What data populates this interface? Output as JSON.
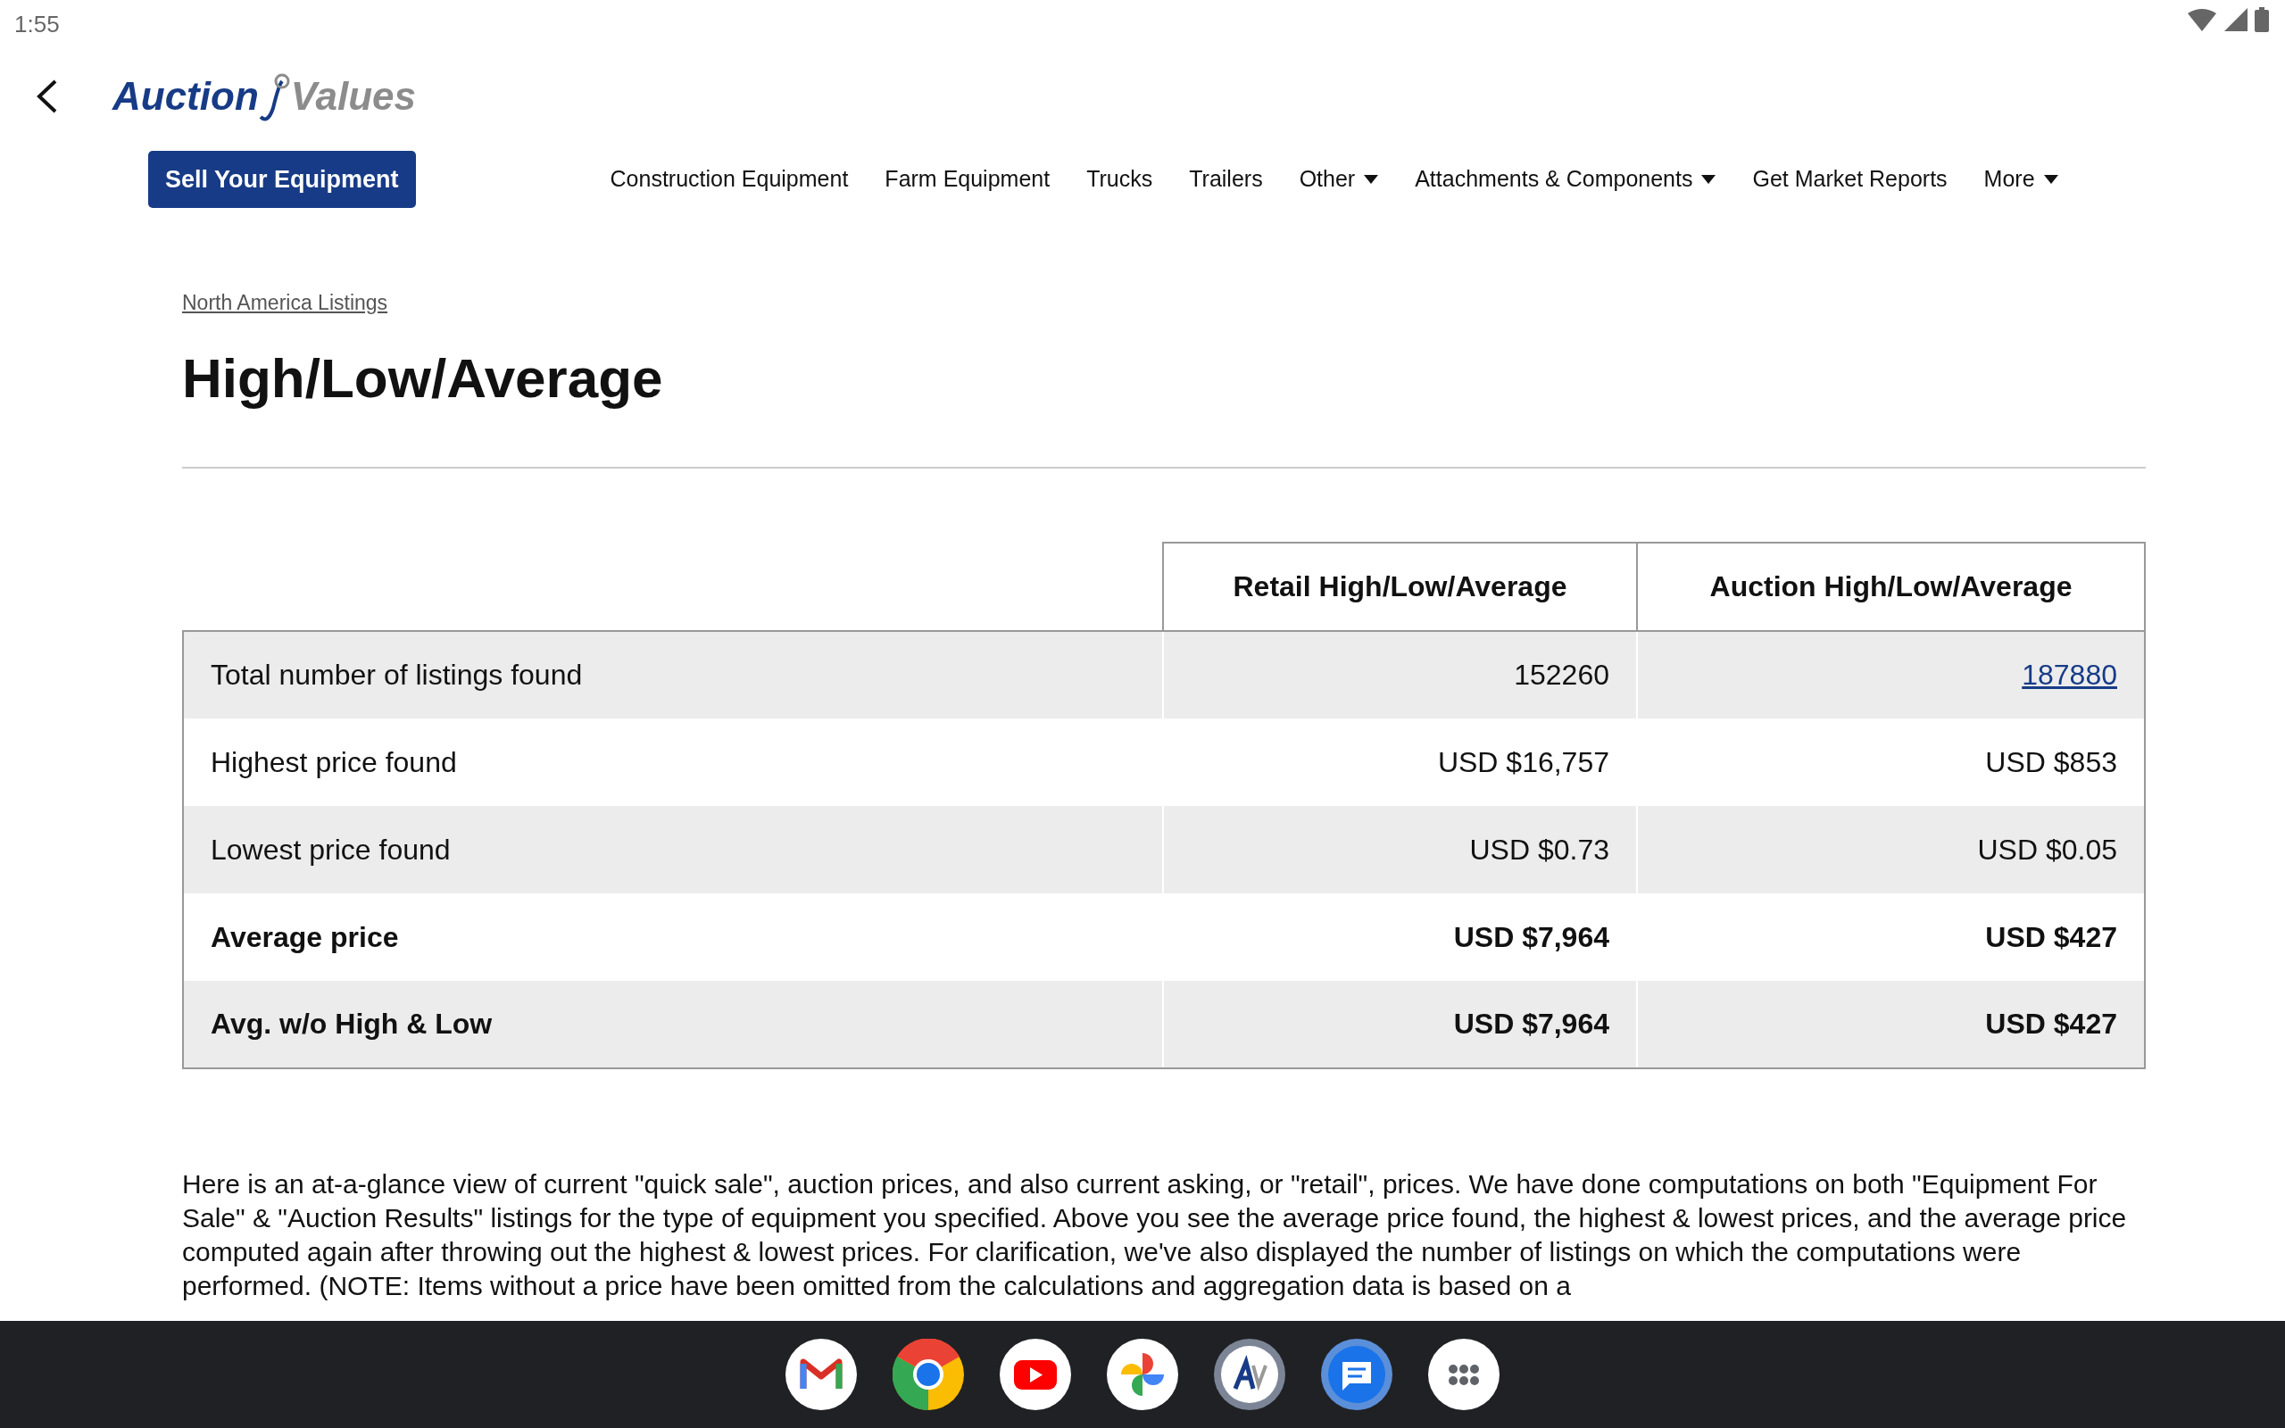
{
  "status_bar": {
    "time": "1:55"
  },
  "logo": {
    "part_1": "Auction",
    "part_2": "Values"
  },
  "sell_button": "Sell Your Equipment",
  "nav": [
    {
      "label": "Construction Equipment",
      "dropdown": false
    },
    {
      "label": "Farm Equipment",
      "dropdown": false
    },
    {
      "label": "Trucks",
      "dropdown": false
    },
    {
      "label": "Trailers",
      "dropdown": false
    },
    {
      "label": "Other",
      "dropdown": true
    },
    {
      "label": "Attachments & Components",
      "dropdown": true
    },
    {
      "label": "Get Market Reports",
      "dropdown": false
    },
    {
      "label": "More",
      "dropdown": true
    }
  ],
  "breadcrumb": "North America Listings",
  "title": "High/Low/Average",
  "table": {
    "columns": [
      "Retail High/Low/Average",
      "Auction High/Low/Average"
    ],
    "rows": [
      {
        "label": "Total number of listings found",
        "retail": "152260",
        "auction": "187880",
        "bold": false,
        "auction_link": true
      },
      {
        "label": "Highest price found",
        "retail": "USD $16,757",
        "auction": "USD $853",
        "bold": false,
        "auction_link": false
      },
      {
        "label": "Lowest price found",
        "retail": "USD $0.73",
        "auction": "USD $0.05",
        "bold": false,
        "auction_link": false
      },
      {
        "label": "Average price",
        "retail": "USD $7,964",
        "auction": "USD $427",
        "bold": true,
        "auction_link": false
      },
      {
        "label": "Avg. w/o High & Low",
        "retail": "USD $7,964",
        "auction": "USD $427",
        "bold": true,
        "auction_link": false
      }
    ]
  },
  "description": "Here is an at-a-glance view of current \"quick sale\", auction prices, and also current asking, or \"retail\", prices. We have done computations on both \"Equipment For Sale\" & \"Auction Results\" listings for the type of equipment you specified. Above you see the average price found, the highest & lowest prices, and the average price computed again after throwing out the highest & lowest prices. For clarification, we've also displayed the number of listings on which the computations were performed. (NOTE: Items without a price have been omitted from the calculations and aggregation data is based on a"
}
